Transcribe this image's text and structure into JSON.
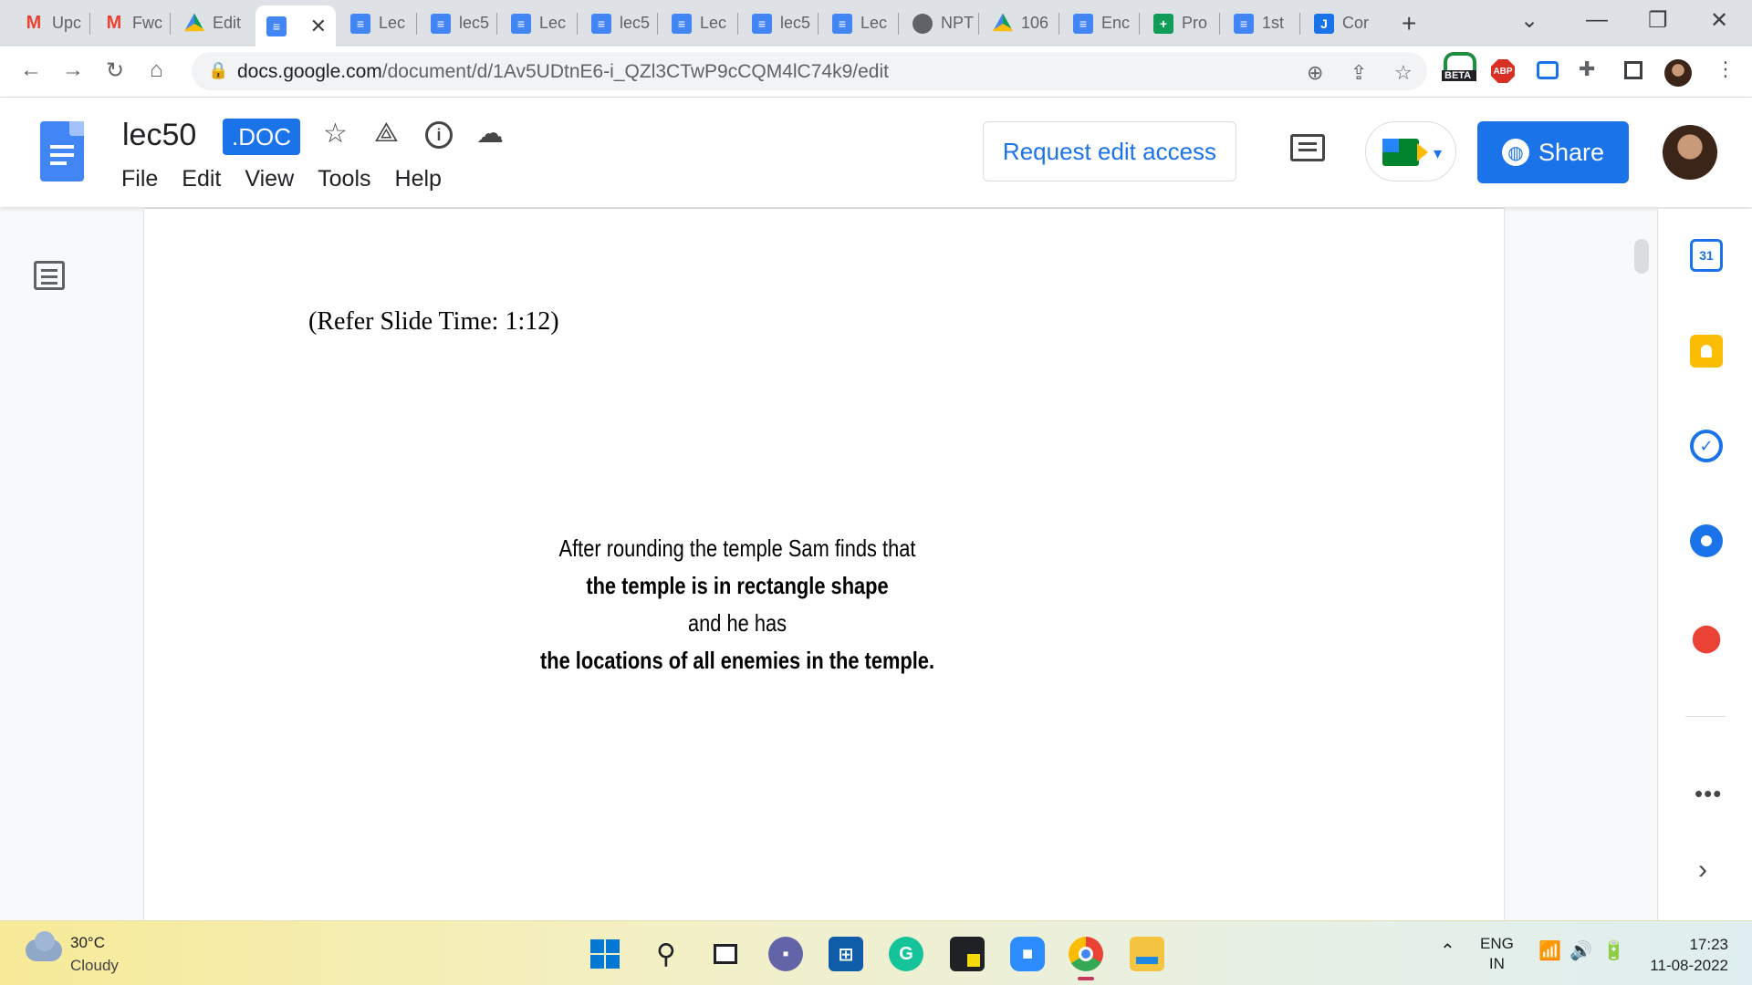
{
  "browser": {
    "tabs": [
      {
        "title": "Upc",
        "icon": "gmail-icon"
      },
      {
        "title": "Fwc",
        "icon": "gmail-icon"
      },
      {
        "title": "Edit",
        "icon": "google-drive-icon"
      },
      {
        "title": "",
        "icon": "google-docs-icon",
        "active": true
      },
      {
        "title": "Lec",
        "icon": "google-docs-icon"
      },
      {
        "title": "lec5",
        "icon": "google-docs-icon"
      },
      {
        "title": "Lec",
        "icon": "google-docs-icon"
      },
      {
        "title": "lec5",
        "icon": "google-docs-icon"
      },
      {
        "title": "Lec",
        "icon": "google-docs-icon"
      },
      {
        "title": "lec5",
        "icon": "google-docs-icon"
      },
      {
        "title": "Lec",
        "icon": "google-docs-icon"
      },
      {
        "title": "NPT",
        "icon": "globe-icon"
      },
      {
        "title": "106",
        "icon": "google-drive-icon"
      },
      {
        "title": "Enc",
        "icon": "google-docs-icon"
      },
      {
        "title": "Pro",
        "icon": "google-sheets-icon"
      },
      {
        "title": "1st",
        "icon": "google-docs-icon"
      },
      {
        "title": "Cor",
        "icon": "jamboard-icon"
      }
    ],
    "url_domain": "docs.google.com",
    "url_path": "/document/d/1Av5UDtnE6-i_QZl3CTwP9cCQM4lC74k9/edit",
    "extension_badge": "BETA",
    "abp_label": "ABP"
  },
  "docs": {
    "title": "lec50",
    "badge": ".DOC",
    "menu": [
      "File",
      "Edit",
      "View",
      "Tools",
      "Help"
    ],
    "request_edit": "Request edit access",
    "share": "Share"
  },
  "document": {
    "refer": "(Refer Slide Time: 1:12)",
    "slide_lines": [
      {
        "text": "After rounding the temple Sam finds that",
        "bold": false
      },
      {
        "text": "the temple is in rectangle shape",
        "bold": true
      },
      {
        "text": "and he has",
        "bold": false
      },
      {
        "text": "the locations of all enemies in the temple.",
        "bold": true
      }
    ]
  },
  "sidepanel": {
    "calendar_day": "31"
  },
  "taskbar": {
    "temperature": "30°C",
    "weather": "Cloudy",
    "lang_top": "ENG",
    "lang_bottom": "IN",
    "time": "17:23",
    "date": "11-08-2022"
  },
  "colors": {
    "accent": "#1a73e8",
    "docs_blue": "#4285f4",
    "tabstrip": "#dee1e6"
  }
}
